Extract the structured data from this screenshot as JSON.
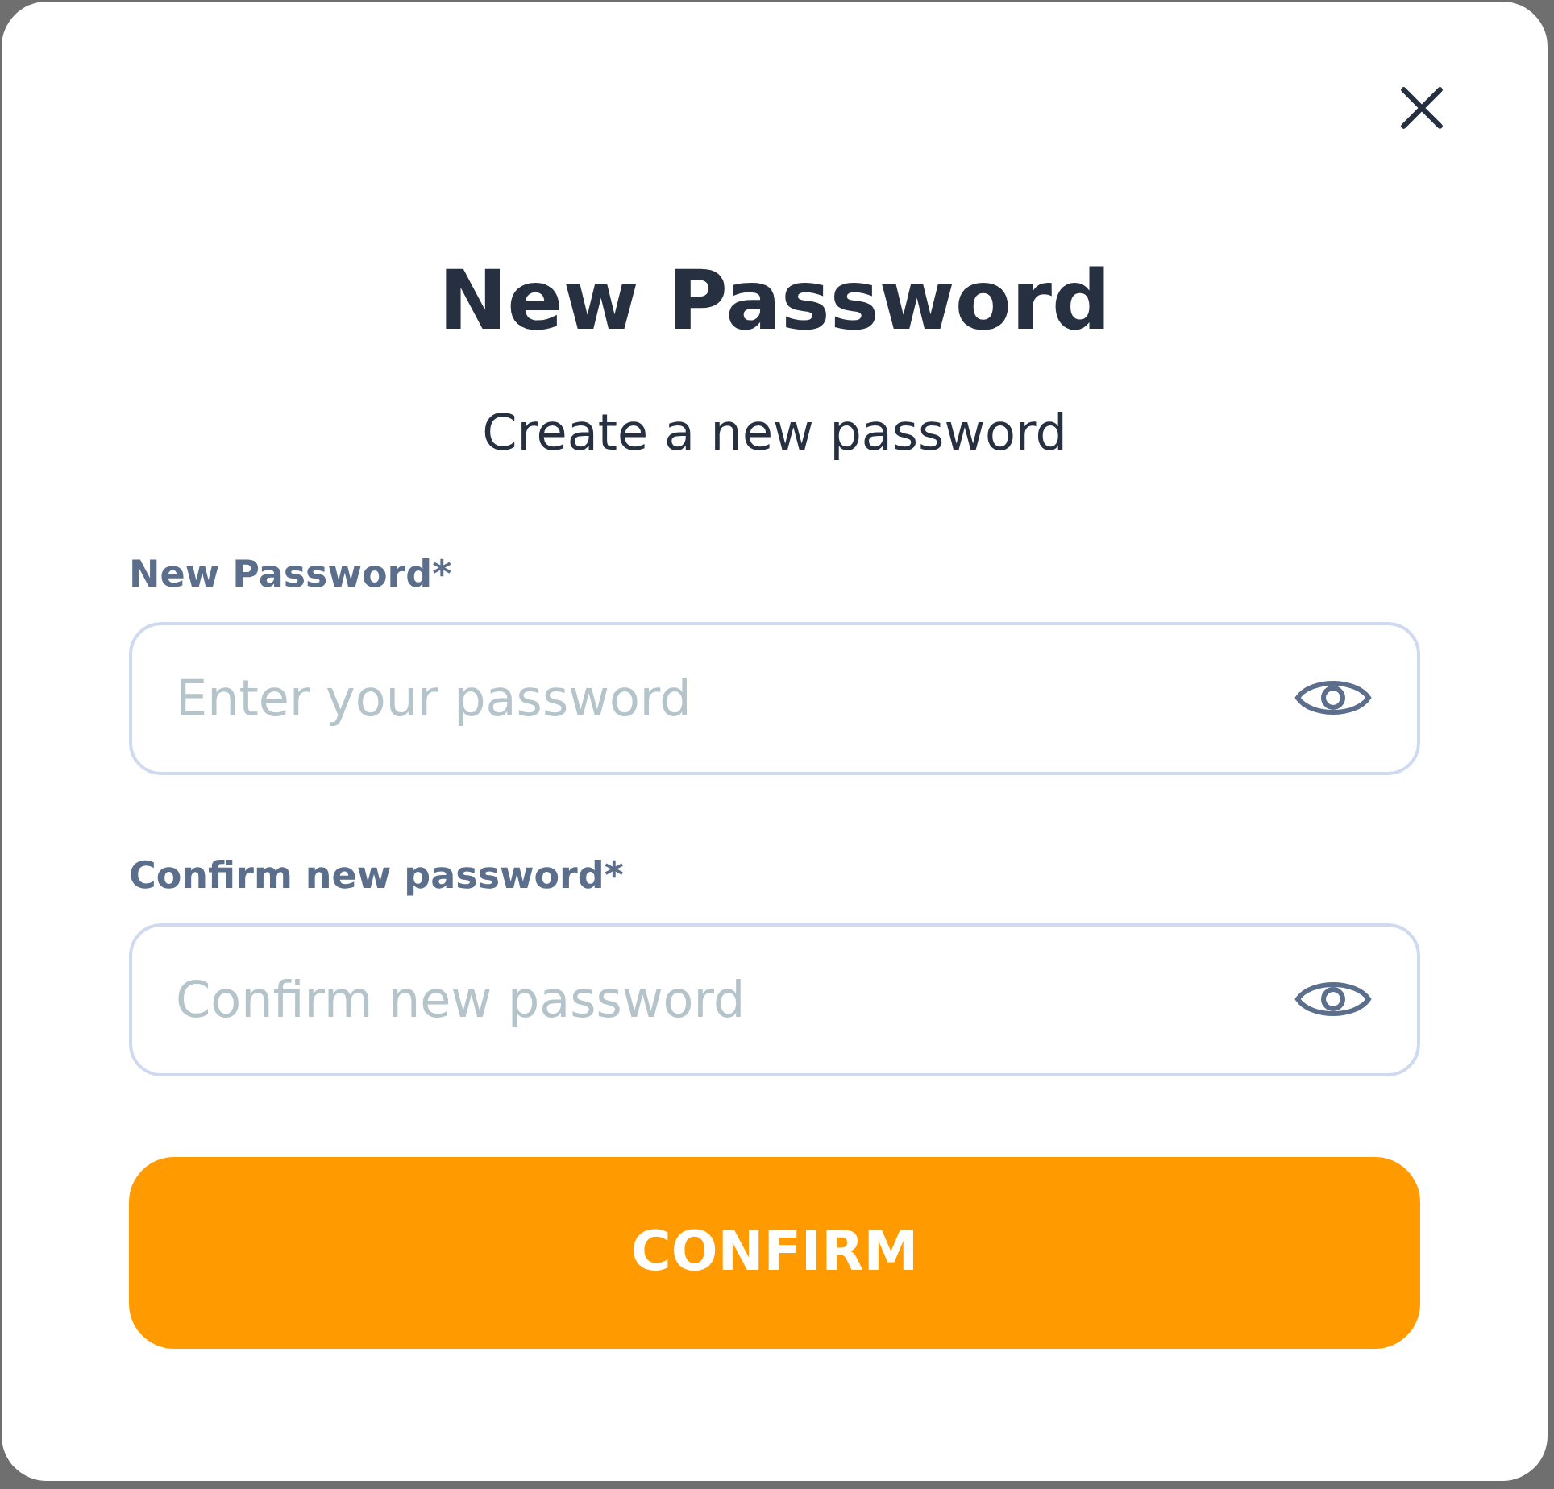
{
  "dialog": {
    "title": "New Password",
    "subtitle": "Create a new password",
    "fields": [
      {
        "label": "New Password*",
        "placeholder": "Enter your password"
      },
      {
        "label": "Confirm new password*",
        "placeholder": "Confirm new password"
      }
    ],
    "button": "CONFIRM"
  }
}
